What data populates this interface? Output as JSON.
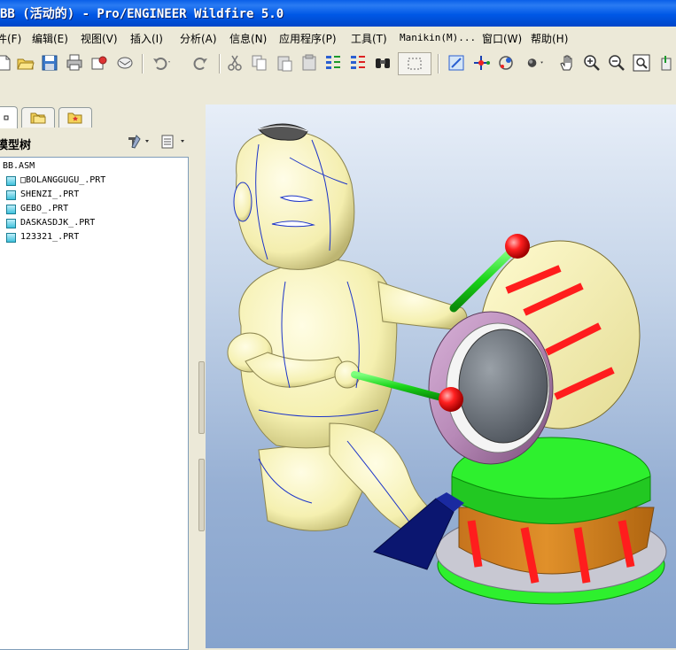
{
  "window": {
    "title": "BB (活动的) - Pro/ENGINEER Wildfire 5.0"
  },
  "menu": [
    {
      "label": "件(F)"
    },
    {
      "label": "编辑(E)"
    },
    {
      "label": "视图(V)"
    },
    {
      "label": "插入(I)"
    },
    {
      "label": "分析(A)"
    },
    {
      "label": "信息(N)"
    },
    {
      "label": "应用程序(P)"
    },
    {
      "label": "工具(T)"
    },
    {
      "label": "Manikin(M)..."
    },
    {
      "label": "窗口(W)"
    },
    {
      "label": "帮助(H)"
    }
  ],
  "toolbar": {
    "icons": [
      "new-icon",
      "open-icon",
      "save-icon",
      "print-icon",
      "send-icon",
      "email-icon",
      "undo-icon",
      "redo-icon",
      "cut-icon",
      "copy-icon",
      "paste-icon",
      "paste-special-icon",
      "regenerate-icon",
      "regen-manager-icon",
      "find-icon",
      "select-box-icon",
      "repaint-icon",
      "spin-center-icon",
      "orient-icon",
      "display-style-icon",
      "pan-icon",
      "zoom-in-icon",
      "zoom-out-icon",
      "refit-icon",
      "more-icon"
    ]
  },
  "navigator": {
    "tabs": [
      {
        "name": "model-tree-tab",
        "icon": "model-tree-icon"
      },
      {
        "name": "folder-browser-tab",
        "icon": "folder-icon"
      },
      {
        "name": "favorites-tab",
        "icon": "favorites-icon"
      }
    ],
    "title": "模型树",
    "tree": {
      "root": "BB.ASM",
      "items": [
        {
          "label": "□BOLANGGUGU_.PRT"
        },
        {
          "label": "SHENZI_.PRT"
        },
        {
          "label": "GEBO_.PRT"
        },
        {
          "label": "DASKASDJK_.PRT"
        },
        {
          "label": "123321_.PRT"
        }
      ]
    }
  },
  "colors": {
    "title_bar": "#0058e6",
    "figure_body": "#fbf7c0",
    "drum_rim": "#b88ab8",
    "drum_band": "#e0902a",
    "drum_base": "#39ff39",
    "stripe": "#ff1d1d",
    "stick": "#19d419",
    "ramp": "#0b1670",
    "viewport_bg": "#97b0d4"
  }
}
